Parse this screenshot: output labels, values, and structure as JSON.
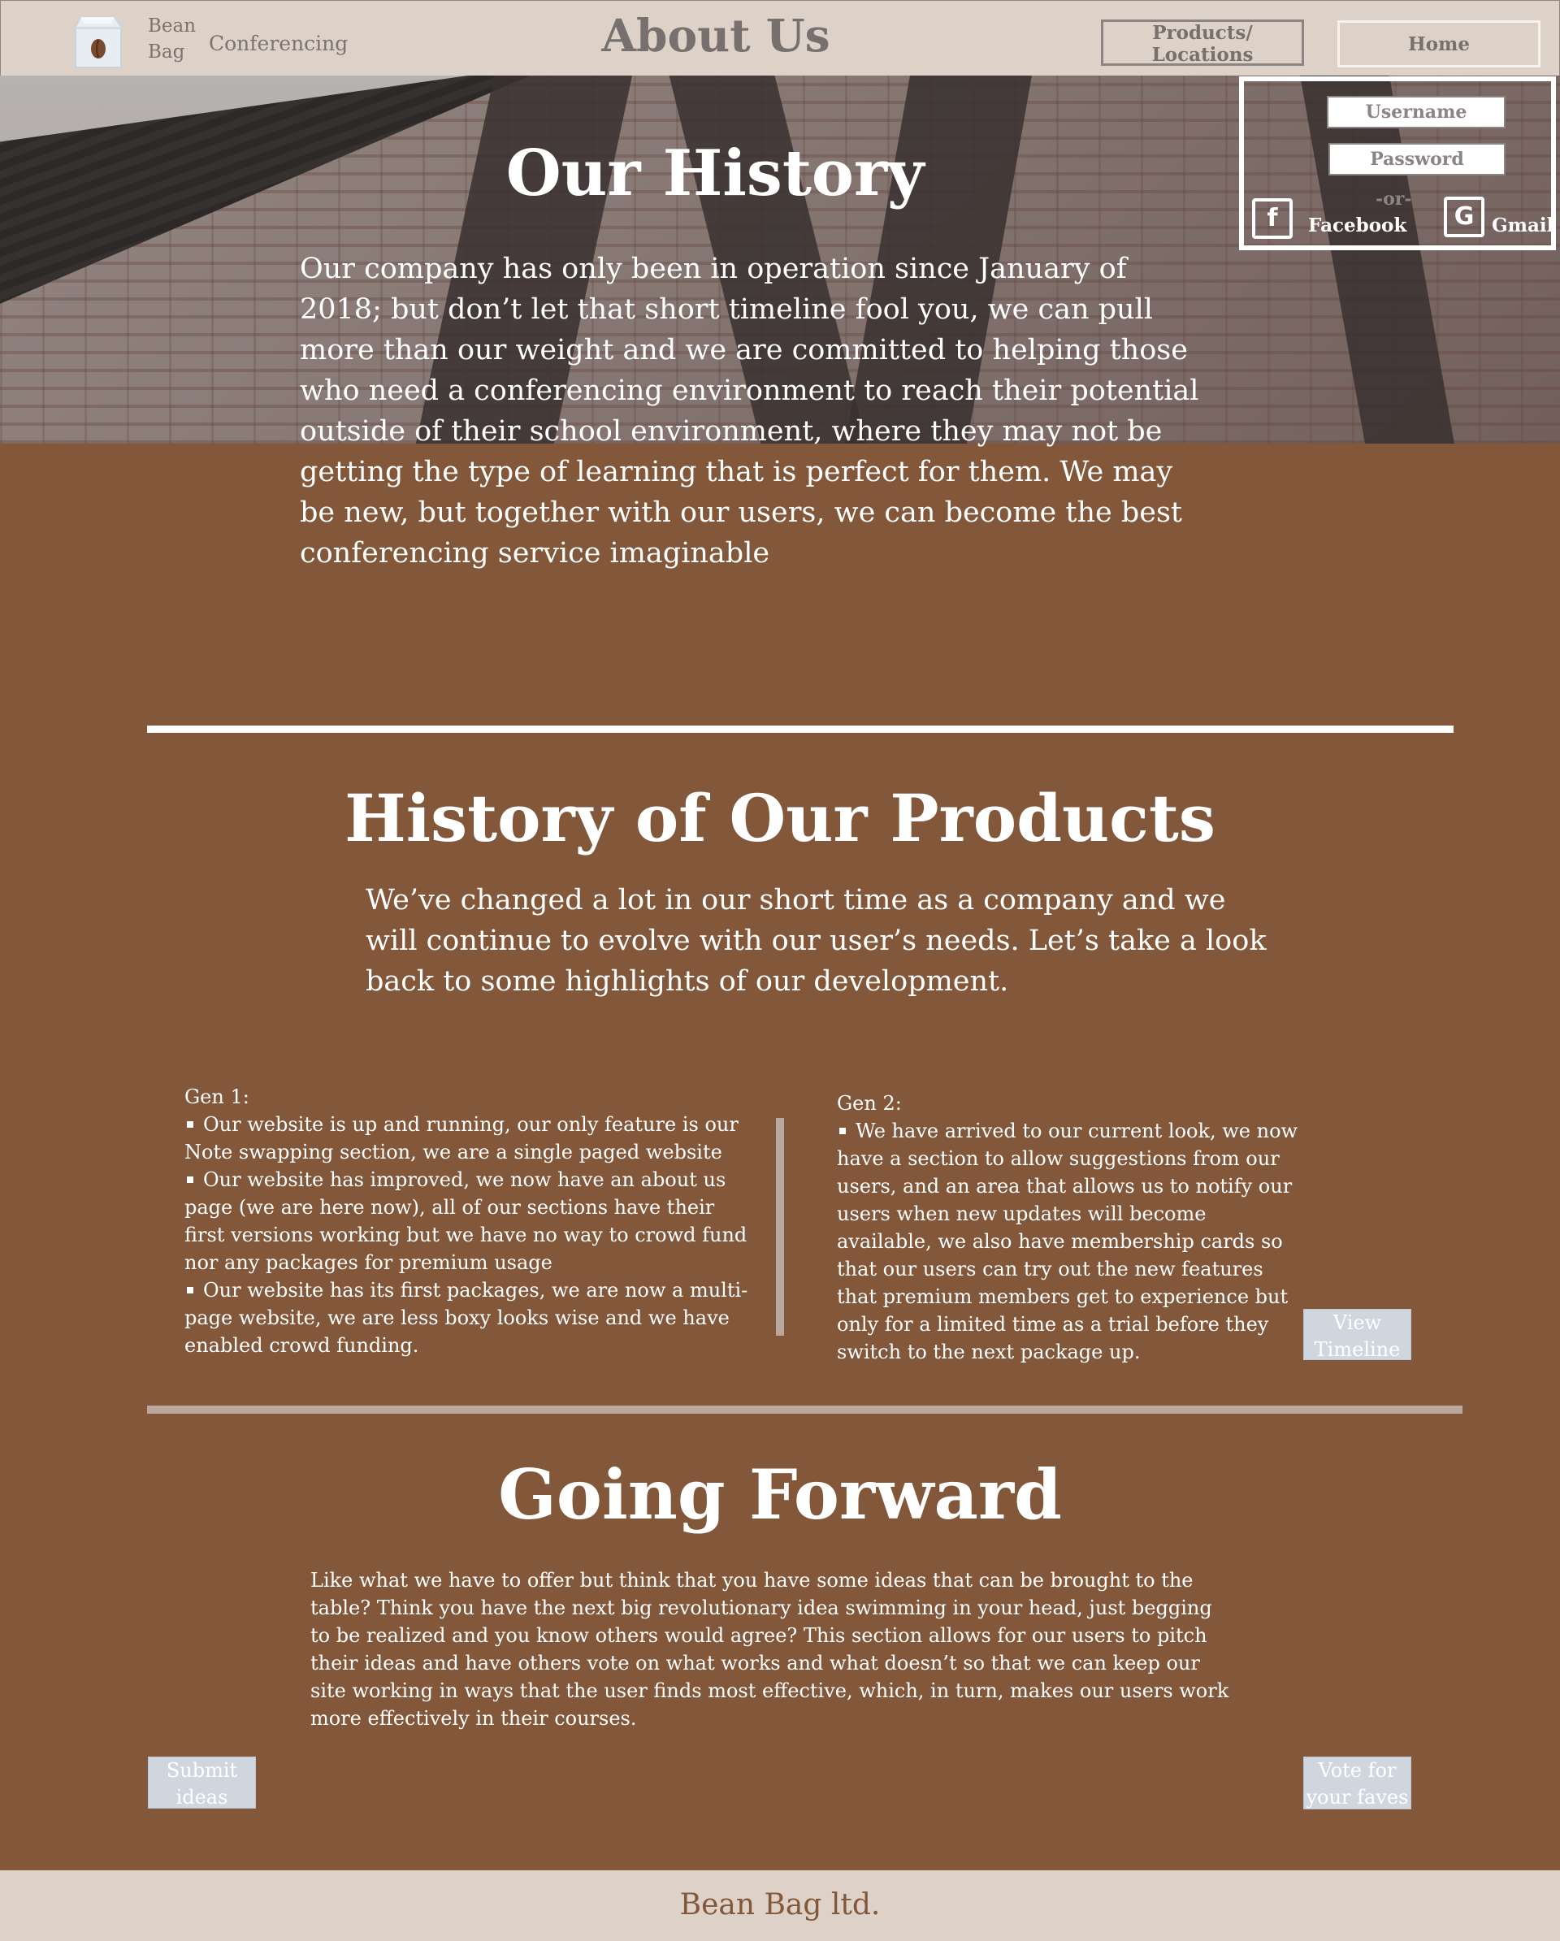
{
  "header": {
    "brand_line1": "Bean",
    "brand_line2": "Bag",
    "brand_sub": "Conferencing",
    "page_title": "About Us",
    "nav_products": "Products/ Locations",
    "nav_home": "Home"
  },
  "login": {
    "username_placeholder": "Username",
    "password_placeholder": "Password",
    "or_text": "-or-",
    "facebook_label": "Facebook",
    "gmail_label": "Gmail"
  },
  "history": {
    "heading": "Our History",
    "body": "Our company has only been in operation since January of 2018; but don’t let that short timeline fool you, we can pull more than our weight and we are committed to helping those who need a conferencing environment to reach their potential outside of their school environment, where they may not be getting the type of learning that is perfect for them. We may be new, but together with our users, we can become the best conferencing service imaginable"
  },
  "products": {
    "heading": "History of Our Products",
    "intro": "We’ve changed a lot in our short time as a company and we will continue to evolve with our user’s needs. Let’s take a look back to some highlights of our development.",
    "gen1": {
      "title": "Gen 1:",
      "items": [
        "Our website is up and running, our only feature is our Note swapping section, we are a single paged website",
        "Our website has improved, we now have an about us page (we are here now), all of our sections have their first versions working but we have no way to crowd fund nor any packages for premium usage",
        "Our website has its first packages, we are now a multi-page website, we are less boxy looks wise and we have enabled crowd funding."
      ]
    },
    "gen2": {
      "title": "Gen 2:",
      "items": [
        "We have arrived to our current look, we now have a section to allow suggestions from our users, and an area that allows us to notify our users when new updates will become available, we also have membership cards so that our users can try out the new features that premium members get to experience but only for a limited time as a trial before they switch to the next package up."
      ]
    },
    "timeline_button": "View Timeline"
  },
  "forward": {
    "heading": "Going Forward",
    "body": " Like what we have to offer but think that you have some ideas that can be brought to the table? Think you have the next big revolutionary idea swimming in your head, just begging to be realized and you know others would agree? This section allows for our users to pitch their ideas and have others vote on what works and what doesn’t so that we can keep our site working in ways that the user finds most effective, which, in turn, makes our users work more effectively in their courses.",
    "submit_button": "Submit ideas",
    "vote_button": "Vote for your faves"
  },
  "footer": {
    "text": "Bean Bag ltd."
  },
  "icons": {
    "logo": "coffee-bag-icon",
    "facebook": "facebook-icon",
    "gmail": "google-icon"
  },
  "colors": {
    "background": "#83573a",
    "header": "#ded1c7",
    "button_light": "#cfd6dd",
    "divider": "#bca79c"
  }
}
